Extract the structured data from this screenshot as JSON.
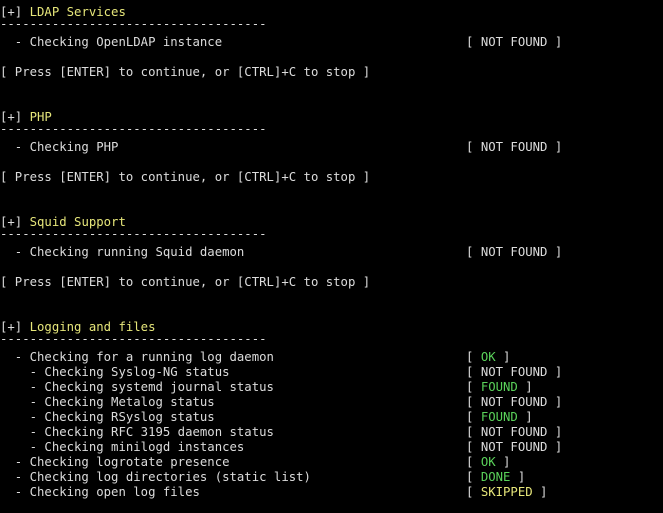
{
  "sections": [
    {
      "title": "[+] LDAP Services",
      "separator": "------------------------------------",
      "checks": [
        {
          "label": "  - Checking OpenLDAP instance",
          "status": "NOT FOUND",
          "color": "white"
        }
      ],
      "prompt": "[ Press [ENTER] to continue, or [CTRL]+C to stop ]"
    },
    {
      "title": "[+] PHP",
      "separator": "------------------------------------",
      "checks": [
        {
          "label": "  - Checking PHP",
          "status": "NOT FOUND",
          "color": "white"
        }
      ],
      "prompt": "[ Press [ENTER] to continue, or [CTRL]+C to stop ]"
    },
    {
      "title": "[+] Squid Support",
      "separator": "------------------------------------",
      "checks": [
        {
          "label": "  - Checking running Squid daemon",
          "status": "NOT FOUND",
          "color": "white"
        }
      ],
      "prompt": "[ Press [ENTER] to continue, or [CTRL]+C to stop ]"
    },
    {
      "title": "[+] Logging and files",
      "separator": "------------------------------------",
      "checks": [
        {
          "label": "  - Checking for a running log daemon",
          "status": "OK",
          "color": "green"
        },
        {
          "label": "    - Checking Syslog-NG status",
          "status": "NOT FOUND",
          "color": "white"
        },
        {
          "label": "    - Checking systemd journal status",
          "status": "FOUND",
          "color": "green"
        },
        {
          "label": "    - Checking Metalog status",
          "status": "NOT FOUND",
          "color": "white"
        },
        {
          "label": "    - Checking RSyslog status",
          "status": "FOUND",
          "color": "green"
        },
        {
          "label": "    - Checking RFC 3195 daemon status",
          "status": "NOT FOUND",
          "color": "white"
        },
        {
          "label": "    - Checking minilogd instances",
          "status": "NOT FOUND",
          "color": "white"
        },
        {
          "label": "  - Checking logrotate presence",
          "status": "OK",
          "color": "green"
        },
        {
          "label": "  - Checking log directories (static list)",
          "status": "DONE",
          "color": "green"
        },
        {
          "label": "  - Checking open log files",
          "status": "SKIPPED",
          "color": "skip"
        }
      ]
    }
  ]
}
